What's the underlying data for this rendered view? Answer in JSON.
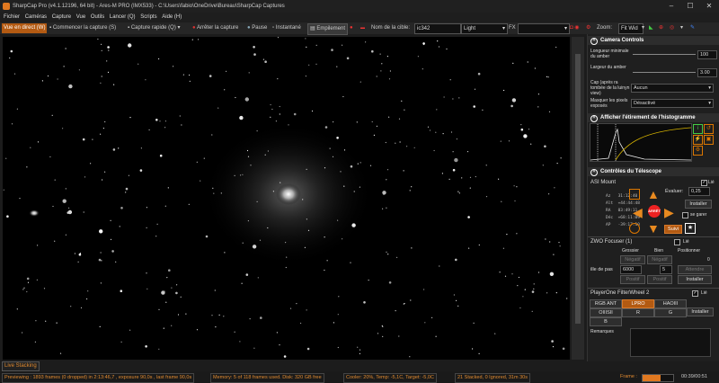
{
  "window": {
    "title": "SharpCap Pro (v4.1.12196, 64 bit) - Ares-M PRO (IMX533) - C:\\Users\\fabio\\OneDrive\\Bureau\\SharpCap Captures",
    "minimize": "–",
    "maximize": "☐",
    "close": "✕"
  },
  "menu": [
    "Fichier",
    "Caméras",
    "Capture",
    "Vue",
    "Outils",
    "Lancer (Q)",
    "Scripts",
    "Aide (H)"
  ],
  "toolbar": {
    "live_view": "Vue en direct (W)",
    "start_capture": "Commencer la capture (S)",
    "quick_capture": "Capture rapide (Q)",
    "stop_capture": "Arrêter la capture",
    "pause": "Pause",
    "snapshot": "Instantané",
    "stacking": "Empilement",
    "target_label": "Nom de la cible:",
    "target_value": "ic342",
    "filter_value": "Light",
    "fx_label": "FX",
    "zoom_label": "Zoom:",
    "zoom_value": "Fit Wid"
  },
  "camera_controls": {
    "header": "Camera Controls",
    "rows": [
      {
        "label": "Longueur minimale du amber",
        "value": "100"
      },
      {
        "label": "Largeur du amber",
        "value": "3.00"
      },
      {
        "label": "Cap (après ra tombée de la luinyn view)",
        "value": "Aucun"
      },
      {
        "label": "Masquer les pixels exposés",
        "value": "Désactivé"
      }
    ]
  },
  "histogram": {
    "header": "Afficher l'étirement de l'histogramme"
  },
  "telescope": {
    "header": "Contrôles du Télescope",
    "mount_name": "ASI Mount",
    "link_label": "Lié",
    "link_checked": "✓",
    "coords": [
      {
        "k": "Az",
        "v": "31:12:40"
      },
      {
        "k": "Alt",
        "v": "+44:44:48"
      },
      {
        "k": "RA",
        "v": "03:49:11"
      },
      {
        "k": "Déc",
        "v": "+68:11:09"
      },
      {
        "k": "AP",
        "v": "-39:17:10"
      }
    ],
    "rate_label": "Évaluer:",
    "rate_value": "0,25",
    "install": "Installer",
    "stop": "ARRÊT",
    "follow": "Suivi",
    "goto_label": "se garer"
  },
  "focuser": {
    "header": "ZWO Focuser (1)",
    "link_label": "Lié",
    "coarse": "Grossier",
    "fine": "Bien",
    "position_label": "Positionner",
    "position_value": "0",
    "neg1": "Négatif",
    "neg2": "Négatif",
    "step_label": "ille de pas",
    "step_coarse": "6000",
    "step_fine": "5",
    "wait": "Attendre",
    "pos1": "Positif",
    "pos2": "Positif",
    "install": "Installer"
  },
  "filterwheel": {
    "header": "PlayerOne FilterWheel 2",
    "link_label": "Lié",
    "link_checked": "✓",
    "filters": [
      "RGB ANT",
      "LPRO",
      "HAOIII",
      "OIIISII",
      "R",
      "G",
      "B"
    ],
    "active_filter": "LPRO",
    "install": "Installer",
    "remarks_label": "Remarques"
  },
  "live_stacking": "Live Stacking",
  "status": {
    "preview": "Previewing : 1893 frames (0 dropped) in 2:13:46,7 , exposure 90,0s , last frame 90,0s",
    "memory": "Memory: 5 of 118 frames used. Disk: 320 GB free",
    "cooler": "Cooler: 20%, Temp: -5,1C, Target: -5,0C",
    "stacked": "21 Stacked, 0 Ignored, 31m 30s",
    "frame_label": "Frame :",
    "frame_progress": 0.6,
    "time": "00:39/00:51"
  }
}
